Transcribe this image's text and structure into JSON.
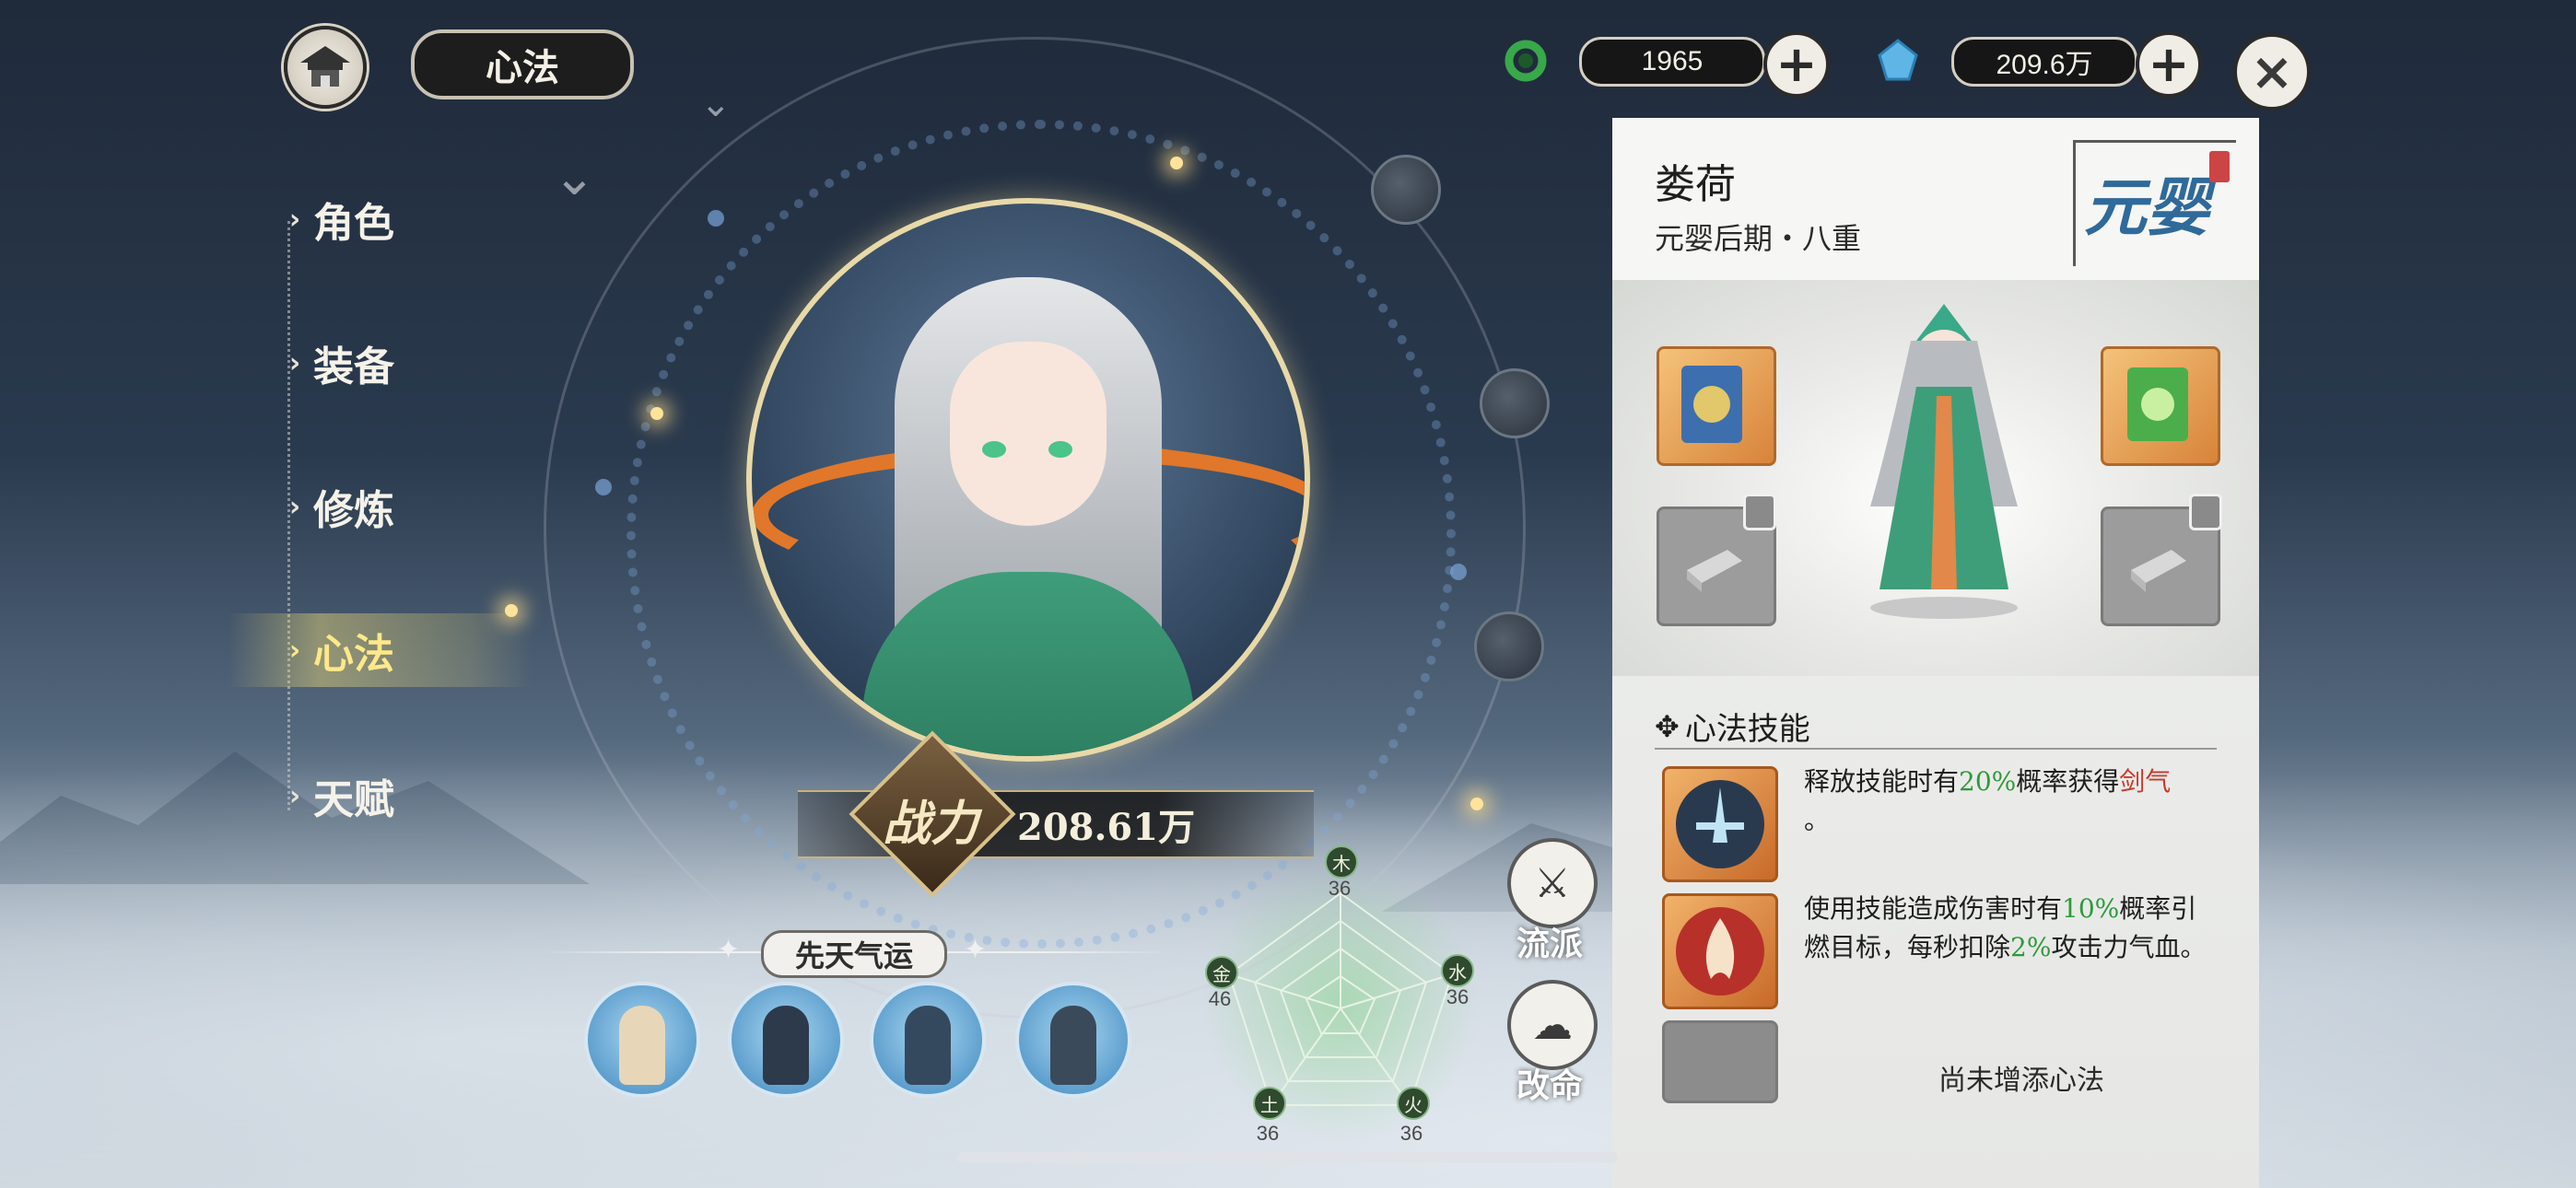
{
  "header": {
    "page_title": "心法",
    "currency_1": {
      "icon": "jade-ring-icon",
      "value": "1965"
    },
    "currency_2": {
      "icon": "blue-crystal-icon",
      "value": "209.6万"
    },
    "plus_symbol": "+",
    "close_symbol": "×"
  },
  "nav": {
    "items": [
      {
        "label": "角色",
        "active": false
      },
      {
        "label": "装备",
        "active": false
      },
      {
        "label": "修炼",
        "active": false
      },
      {
        "label": "心法",
        "active": true
      },
      {
        "label": "天赋",
        "active": false
      }
    ]
  },
  "power": {
    "label": "战力",
    "value": "208.61万"
  },
  "fortune": {
    "title": "先天气运",
    "slots": [
      "fortune-1",
      "fortune-2",
      "fortune-3",
      "fortune-4"
    ]
  },
  "elements": {
    "wood": {
      "label": "木",
      "value": "36"
    },
    "water": {
      "label": "水",
      "value": "36"
    },
    "fire": {
      "label": "火",
      "value": "36"
    },
    "earth": {
      "label": "土",
      "value": "36"
    },
    "metal": {
      "label": "金",
      "value": "46"
    }
  },
  "side_buttons": {
    "school": "流派",
    "destiny": "改命"
  },
  "panel": {
    "name": "娄荷",
    "rank": "元婴后期・八重",
    "realm": "元婴",
    "section_title": "心法技能",
    "skills": [
      {
        "pre": "释放技能时有",
        "pct": "20%",
        "mid": "概率获得",
        "key": "剑气",
        "post": "。"
      },
      {
        "pre": "使用技能造成伤害时有",
        "pct": "10%",
        "mid": "概率引燃目标，每秒扣除",
        "pct2": "2%",
        "post": "攻击力气血。"
      }
    ],
    "empty_label": "尚未增添心法"
  },
  "colors": {
    "accent_gold": "#ffe88a",
    "highlight_green": "#2e9a3a",
    "highlight_red": "#c83a2a"
  }
}
